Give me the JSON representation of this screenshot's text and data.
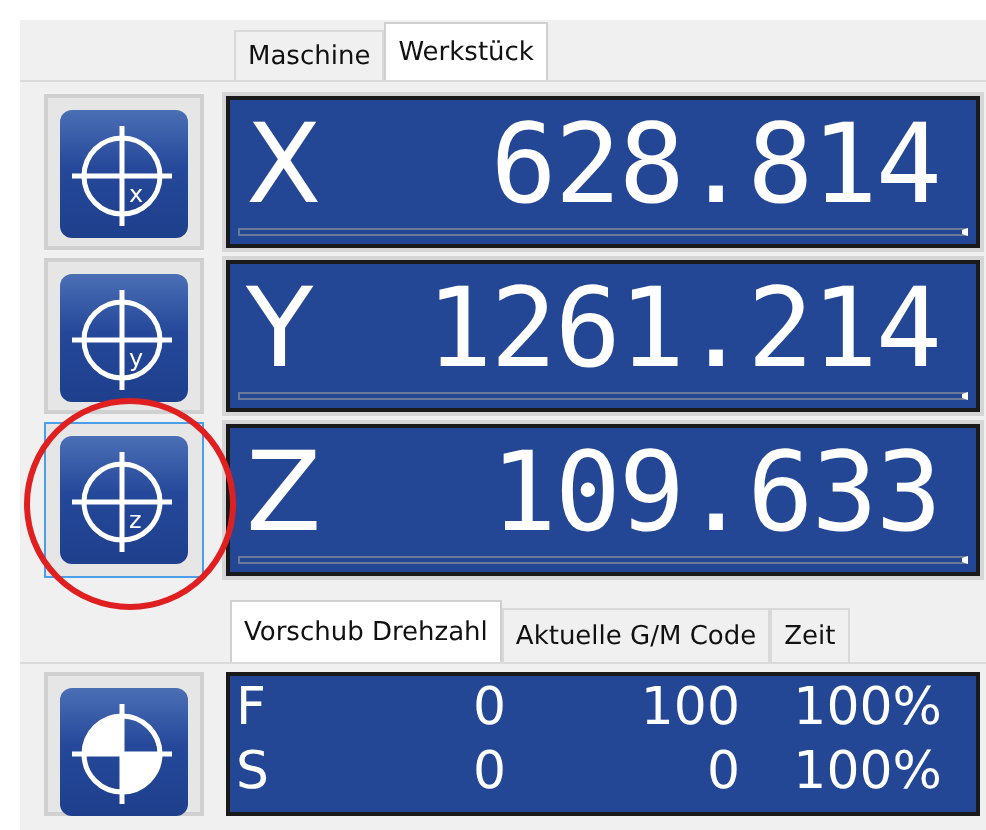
{
  "top_tabs": [
    {
      "label": "Maschine",
      "selected": false
    },
    {
      "label": "Werkstück",
      "selected": true
    }
  ],
  "axes": [
    {
      "letter": "X",
      "value": "628.814",
      "icon_label": "x",
      "focused": false,
      "circled": false
    },
    {
      "letter": "Y",
      "value": "1261.214",
      "icon_label": "y",
      "focused": false,
      "circled": false
    },
    {
      "letter": "Z",
      "value": "109.633",
      "icon_label": "z",
      "focused": true,
      "circled": true
    }
  ],
  "bottom_tabs": [
    {
      "label": "Vorschub Drehzahl",
      "selected": true
    },
    {
      "label": "Aktuelle G/M Code",
      "selected": false
    },
    {
      "label": "Zeit",
      "selected": false
    }
  ],
  "feed_rows": [
    {
      "letter": "F",
      "actual": "0",
      "set": "100",
      "override": "100%"
    },
    {
      "letter": "S",
      "actual": "0",
      "set": "0",
      "override": "100%"
    }
  ]
}
